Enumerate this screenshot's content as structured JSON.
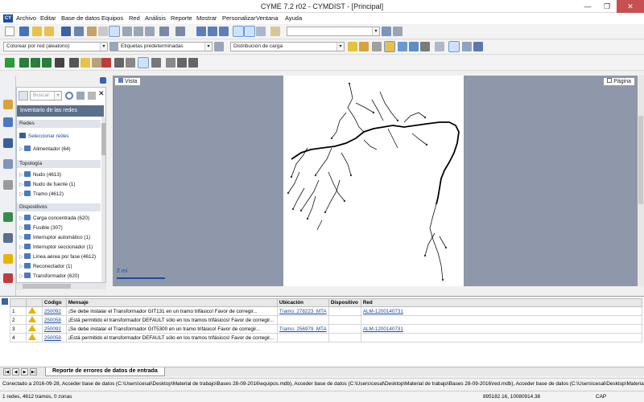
{
  "window": {
    "title": "CYME 7.2 r02 - CYMDIST - [Principal]",
    "app_icon": "CY"
  },
  "menu": [
    "Archivo",
    "Editar",
    "Base de datos",
    "Equipos",
    "Red",
    "Análisis",
    "Reporte",
    "Mostrar",
    "Personalizar",
    "Ventana",
    "Ayuda"
  ],
  "toolbar2": {
    "color_combo": "Colorear por red (aleatorio)",
    "labels_combo": "Etiquetas predeterminadas",
    "dist_combo": "Distribución de carga"
  },
  "inventory": {
    "search_placeholder": "Buscar",
    "header": "Inventario de las redes",
    "sections": {
      "redes": "Redes",
      "topologia": "Topología",
      "dispositivos": "Dispositivos"
    },
    "redes_items": [
      "Seleccionar redes",
      "Alimentador (64)"
    ],
    "topologia_items": [
      "Nudo (4613)",
      "Nudo de fuente (1)",
      "Tramo (4612)"
    ],
    "dispositivos_items": [
      "Carga concentrada (620)",
      "Fusible (307)",
      "Interruptor automático (1)",
      "Interruptor seccionador (1)",
      "Línea aérea por fase (4612)",
      "Reconectador (1)",
      "Transformador (620)"
    ]
  },
  "map": {
    "tab_vista": "Vista",
    "tab_pagina": "Página",
    "scale": "2 mi"
  },
  "messages": {
    "columns": [
      "",
      "",
      "Código",
      "Mensaje",
      "Ubicación",
      "Dispositivo",
      "Red"
    ],
    "rows": [
      {
        "n": "1",
        "code": "250092",
        "msg": "¡Se debe instalar el Transformador GIT131 en un tramo trifásico! Favor de corregir...",
        "loc": "Tramo: 278223_MTA",
        "dev": "",
        "red": "ALM-1200140731"
      },
      {
        "n": "2",
        "code": "250058",
        "msg": "¡Está permitido el transformador DEFAULT sólo en los tramos trifásicos! Favor de corregir...",
        "loc": "",
        "dev": "",
        "red": ""
      },
      {
        "n": "3",
        "code": "250092",
        "msg": "¡Se debe instalar el Transformador GIT5300 en un tramo trifásico! Favor de corregir...",
        "loc": "Tramo: 256979_MTA",
        "dev": "",
        "red": "ALM-1200140731"
      },
      {
        "n": "4",
        "code": "250058",
        "msg": "¡Está permitido el transformador DEFAULT sólo en los tramos trifásicos! Favor de corregir...",
        "loc": "",
        "dev": "",
        "red": ""
      }
    ]
  },
  "bottom_tab": "Reporte de errores de datos de entrada",
  "status": {
    "line1": "Conectado a 2016-09-28, Acceder base de datos (C:\\Users\\cesal\\Desktop\\Material de trabajo\\Bases 28-09-2016\\equipos.mdb), Acceder base de datos (C:\\Users\\cesal\\Desktop\\Material de trabajo\\Bases 28-09-2016\\red.mdb), Acceder base de datos (C:\\Users\\cesal\\Desktop\\Material de trabajo\\Bases 28-09-2016\\equipos.mdb)",
    "line2": "1 redes, 4612 tramos, 0 zonas",
    "coords": "895182.16, 10080914.38",
    "cap": "CAP"
  },
  "colors": {
    "accent": "#5b6f8c",
    "map_bg": "#8e98aa",
    "warning": "#e7b400",
    "link": "#1a4aa0",
    "close": "#c75050"
  }
}
